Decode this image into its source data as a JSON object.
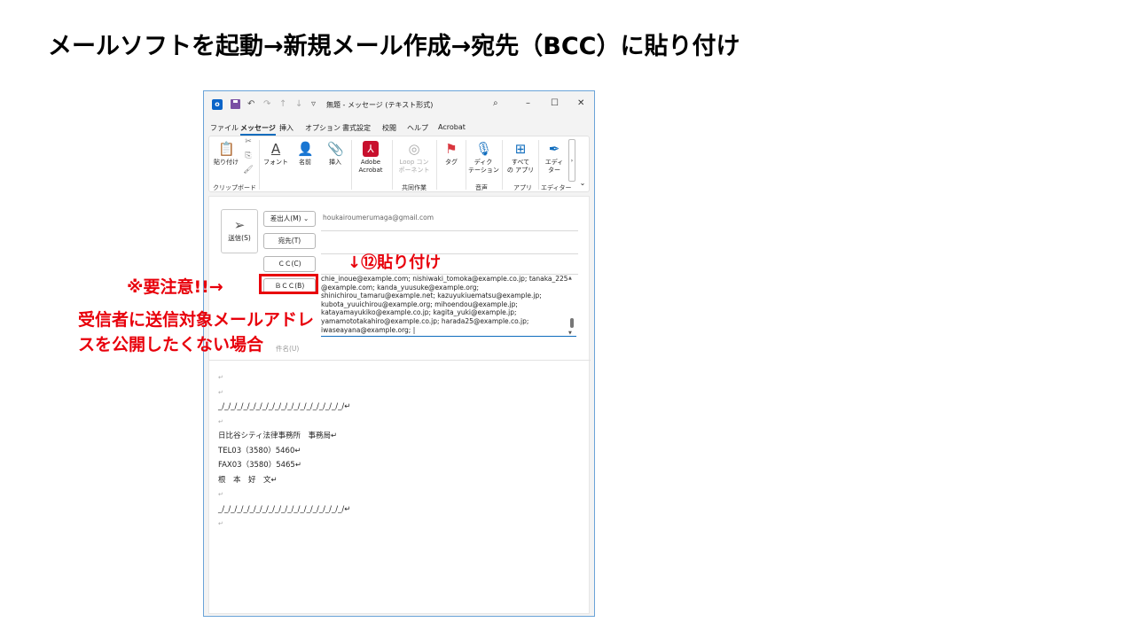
{
  "slide_title": "メールソフトを起動→新規メール作成→宛先（BCC）に貼り付け",
  "window": {
    "title": "無題 - メッセージ (テキスト形式)",
    "qat": {
      "undo": "↶",
      "redo": "↷",
      "up": "↑",
      "down": "↓",
      "more": "▿"
    },
    "search_glyph": "⌕",
    "minimize": "–",
    "maximize": "☐",
    "close": "✕",
    "menu": [
      "ファイル",
      "メッセージ",
      "挿入",
      "オプション",
      "書式設定",
      "校閲",
      "ヘルプ",
      "Acrobat"
    ],
    "active_menu_index": 1
  },
  "ribbon": {
    "paste": "貼り付け",
    "font": "フォント",
    "names": "名前",
    "insert": "挿入",
    "adobe_line1": "Adobe",
    "adobe_line2": "Acrobat",
    "loop_line1": "Loop コン",
    "loop_line2": "ポーネント",
    "tag": "タグ",
    "dictate_line1": "ディク",
    "dictate_line2": "テーション",
    "apps_line1": "すべて",
    "apps_line2": "の アプリ",
    "editor_line1": "エディ",
    "editor_line2": "ター",
    "group_clipboard": "クリップボード",
    "group_collab": "共同作業",
    "group_voice": "音声",
    "group_apps": "アプリ",
    "group_editor": "エディター"
  },
  "compose": {
    "send": "送信(S)",
    "from_btn": "差出人(M) ⌄",
    "from_value": "houkairoumerumaga@gmail.com",
    "to_btn": "宛先(T)",
    "cc_btn": "ＣＣ(C)",
    "bcc_btn": "ＢＣＣ(B)",
    "bcc_lines": [
      "chie_inoue@example.com; nishiwaki_tomoka@example.co.jp; tanaka_225",
      "@example.com; kanda_yuusuke@example.org;",
      "shinichirou_tamaru@example.net; kazuyukiuematsu@example.jp;",
      "kubota_yuuichirou@example.org; mihoendou@example.jp;",
      "katayamayukiko@example.co.jp; kagita_yuki@example.jp;",
      "yamamototakahiro@example.co.jp; harada25@example.co.jp;",
      "iwaseayana@example.org; |"
    ],
    "subject_label": "件名(U)",
    "body_lines": [
      "↵",
      "↵",
      "_/_/_/_/_/_/_/_/_/_/_/_/_/_/_/_/_/_/_/_/↵",
      "↵",
      "日比谷シティ法律事務所　事務局↵",
      "TEL03（3580）5460↵",
      "FAX03（3580）5465↵",
      "根　本　好　文↵",
      "↵",
      "_/_/_/_/_/_/_/_/_/_/_/_/_/_/_/_/_/_/_/_/↵",
      "↵"
    ]
  },
  "annotations": {
    "paste_step": "↓⑫貼り付け",
    "caution": "※要注意!!→",
    "explain": "受信者に送信対象メールアドレスを公開したくない場合"
  },
  "colors": {
    "annotation_red": "#e8000b",
    "accent_blue": "#0f6cbd",
    "window_border": "#6aa3d8"
  }
}
